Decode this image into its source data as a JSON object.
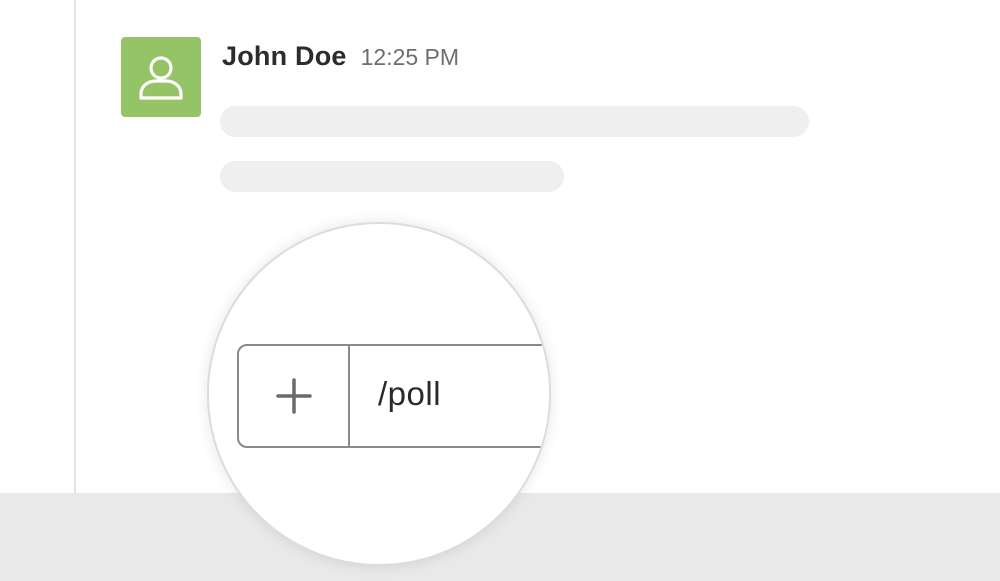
{
  "message": {
    "author": "John Doe",
    "timestamp": "12:25 PM",
    "avatar_color": "#94c466",
    "avatar_icon": "user-icon"
  },
  "composer": {
    "attach_icon": "plus-icon",
    "input_value": "/poll"
  },
  "colors": {
    "background": "#ffffff",
    "bottom_bar": "#e9e9e9",
    "skeleton": "#efefef"
  }
}
